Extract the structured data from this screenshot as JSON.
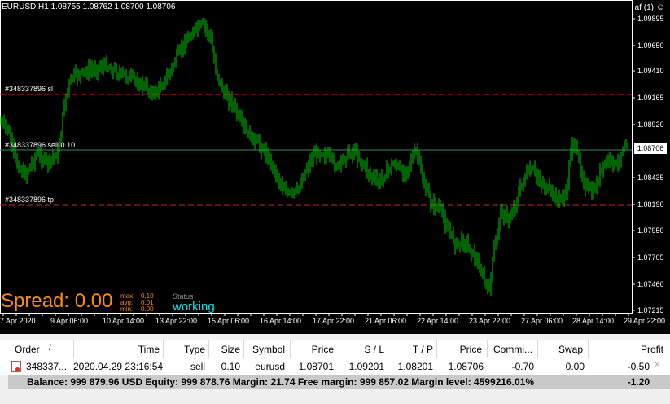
{
  "chart": {
    "symbol_info": "EURUSD,H1  1.08755 1.08762 1.08700 1.08706",
    "top_right": "af (1)",
    "smiley": "☺",
    "price_labels": [
      "1.09895",
      "1.09650",
      "1.09410",
      "1.09165",
      "1.08920",
      "1.08435",
      "1.08190",
      "1.07950",
      "1.07705",
      "1.07460",
      "1.07215"
    ],
    "current_price": "1.08706",
    "time_labels": [
      "7 Apr 2020",
      "9 Apr 06:00",
      "10 Apr 14:00",
      "13 Apr 22:00",
      "15 Apr 06:00",
      "16 Apr 14:00",
      "17 Apr 22:00",
      "21 Apr 06:00",
      "22 Apr 14:00",
      "23 Apr 22:00",
      "27 Apr 06:00",
      "28 Apr 14:00",
      "29 Apr 22:00"
    ],
    "sl_label": "#348337896 sl",
    "order_label": "#348337896 sell 0.10",
    "tp_label": "#348337896 tp",
    "spread": "Spread: 0.00",
    "max_label": "max:",
    "max_value": "0.10",
    "avg_label": "avg:",
    "avg_value": "0.01",
    "min_label": "min:",
    "min_value": "0.00",
    "status_label": "Status",
    "status_value": "working",
    "colors": {
      "candle": "#00c800",
      "sl_tp": "#d42020",
      "order": "#3a8a5a"
    }
  },
  "terminal": {
    "headers": [
      "Order",
      "/",
      "Time",
      "Type",
      "Size",
      "Symbol",
      "Price",
      "S / L",
      "T / P",
      "Price",
      "Commi...",
      "Swap",
      "Profit"
    ],
    "rows": [
      {
        "order": "348337...",
        "time": "2020.04.29 23:16:54",
        "type": "sell",
        "size": "0.10",
        "symbol": "eurusd",
        "price": "1.08701",
        "sl": "1.09201",
        "tp": "1.08201",
        "cur_price": "1.08706",
        "commission": "-0.70",
        "swap": "0.00",
        "profit": "-0.50",
        "close": "×"
      }
    ],
    "summary": {
      "text": "Balance: 999 879.96 USD  Equity: 999 878.76  Margin: 21.74  Free margin: 999 857.02  Margin level: 4599216.01%",
      "profit": "-1.20"
    }
  }
}
